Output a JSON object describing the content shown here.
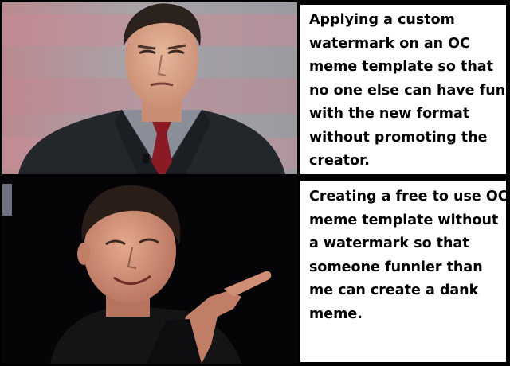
{
  "panels": [
    {
      "caption_lines": [
        "Applying a custom",
        "watermark on an OC",
        "meme template so that",
        "no one else can have fun",
        "with the new format",
        "without promoting the",
        "creator."
      ],
      "image_description_icon": "man-in-suit-squinting"
    },
    {
      "caption_lines": [
        "Creating a free to use OC",
        "meme template without",
        "a watermark so that",
        "someone funnier than",
        "me can create a dank",
        "meme."
      ],
      "image_description_icon": "man-smiling-pointing"
    }
  ],
  "colors": {
    "border": "#000000",
    "caption_background": "#ffffff",
    "caption_text": "#000000"
  }
}
